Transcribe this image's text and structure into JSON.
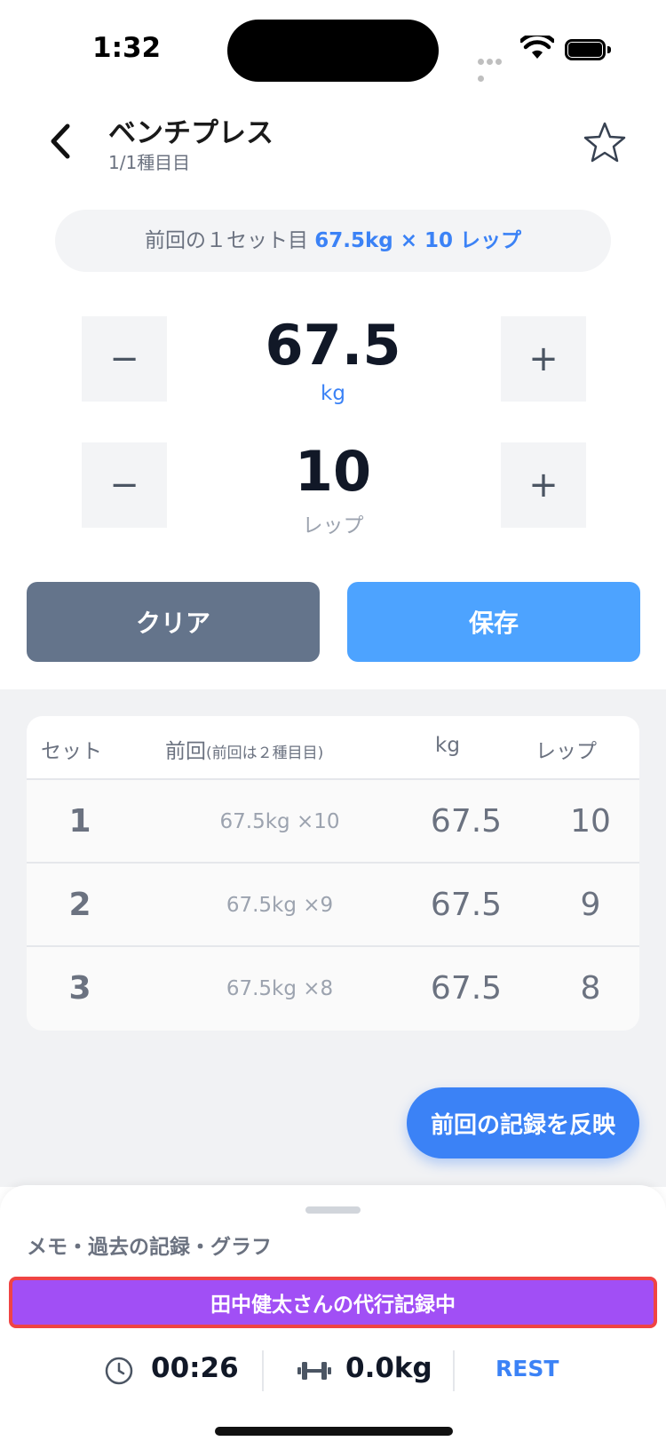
{
  "status": {
    "time": "1:32"
  },
  "header": {
    "title": "ベンチプレス",
    "subtitle": "1/1種目目"
  },
  "previous": {
    "prefix": "前回の１セット目 ",
    "highlight": "67.5kg × 10 レップ"
  },
  "weight_stepper": {
    "value": "67.5",
    "unit": "kg",
    "minus": "−",
    "plus": "+"
  },
  "reps_stepper": {
    "value": "10",
    "unit": "レップ",
    "minus": "−",
    "plus": "+"
  },
  "actions": {
    "clear": "クリア",
    "save": "保存"
  },
  "table": {
    "headers": {
      "set": "セット",
      "prev": "前回",
      "prev_note": "(前回は２種目目)",
      "kg": "kg",
      "reps": "レップ"
    },
    "rows": [
      {
        "set": "1",
        "prev": "67.5kg ×10",
        "kg": "67.5",
        "reps": "10"
      },
      {
        "set": "2",
        "prev": "67.5kg ×9",
        "kg": "67.5",
        "reps": "9"
      },
      {
        "set": "3",
        "prev": "67.5kg ×8",
        "kg": "67.5",
        "reps": "8"
      }
    ]
  },
  "reflect_button": "前回の記録を反映",
  "sheet": {
    "title": "メモ・過去の記録・グラフ",
    "proxy_banner": "田中健太さんの代行記録中"
  },
  "bottom_bar": {
    "timer": "00:26",
    "weight": "0.0kg",
    "rest": "REST"
  },
  "colors": {
    "accent": "#3b82f6",
    "save": "#4da3ff",
    "clear": "#64748b",
    "proxy": "#a14ff5",
    "highlight_border": "#ef4444"
  }
}
